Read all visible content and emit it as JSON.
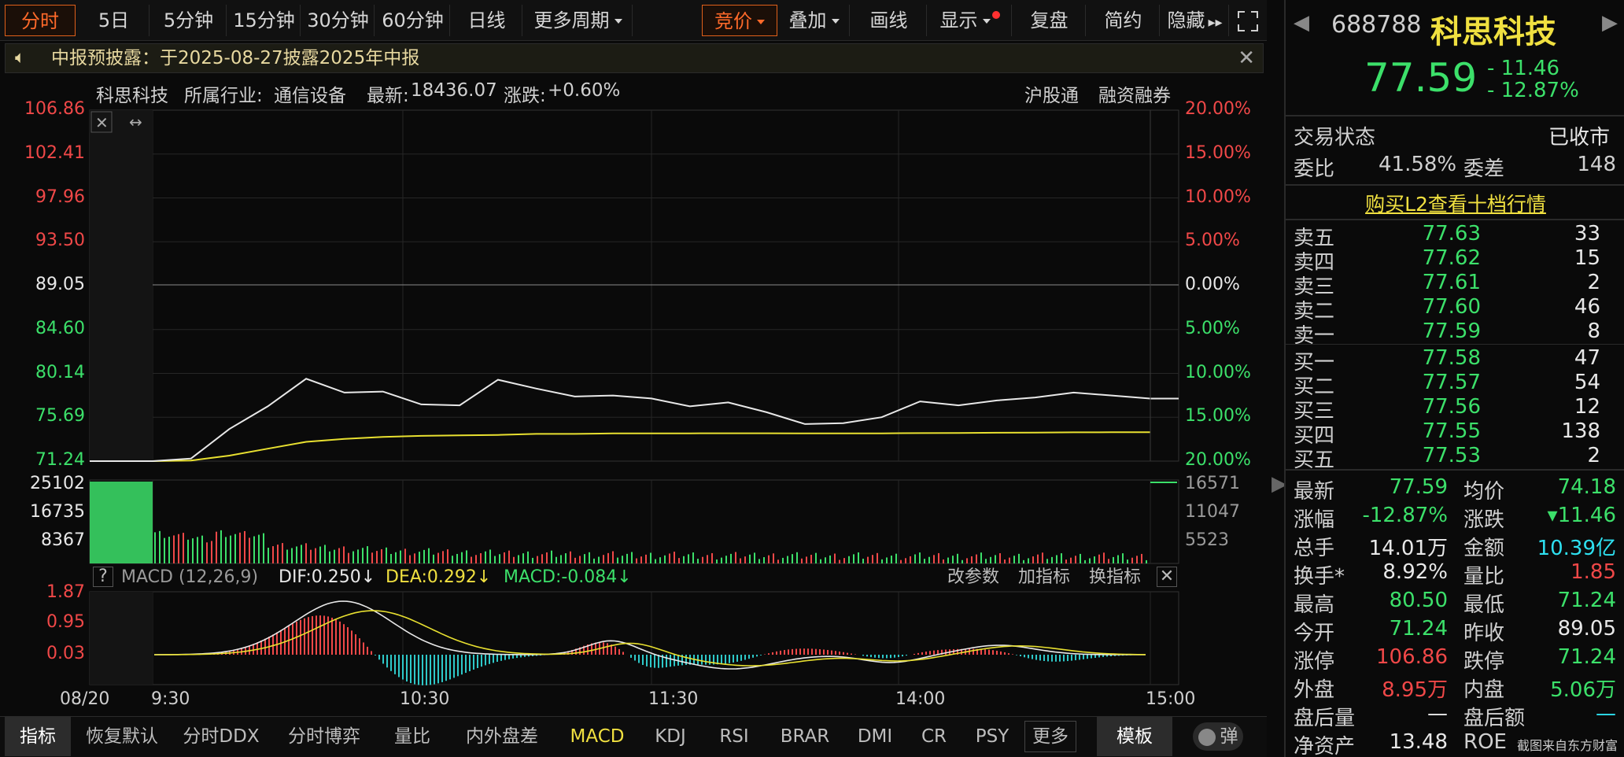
{
  "toolbar": {
    "tabs": [
      "分时",
      "5日",
      "5分钟",
      "15分钟",
      "30分钟",
      "60分钟",
      "日线",
      "更多周期"
    ],
    "right_tabs": [
      "竞价",
      "叠加",
      "画线",
      "显示",
      "复盘",
      "简约",
      "隐藏"
    ]
  },
  "notice": {
    "text": "中报预披露：于2025-08-27披露2025年中报"
  },
  "info_line": {
    "name": "科思科技",
    "industry_label": "所属行业:",
    "industry": "通信设备",
    "latest_label": "最新:",
    "latest": "18436.07",
    "change_label": "涨跌:",
    "change": "+0.60%",
    "tag1": "沪股通",
    "tag2": "融资融券"
  },
  "price_axis": {
    "left": [
      "106.86",
      "102.41",
      "97.96",
      "93.50",
      "89.05",
      "84.60",
      "80.14",
      "75.69",
      "71.24"
    ],
    "right": [
      "20.00%",
      "15.00%",
      "10.00%",
      "5.00%",
      "0.00%",
      "5.00%",
      "10.00%",
      "15.00%",
      "20.00%"
    ]
  },
  "volume_axis": {
    "left": [
      "25102",
      "16735",
      "8367"
    ],
    "right": [
      "16571",
      "11047",
      "5523"
    ]
  },
  "macd_header": {
    "help": "?",
    "name": "MACD (12,26,9)",
    "dif": "DIF:0.250↓",
    "dea": "DEA:0.292↓",
    "macd": "MACD:-0.084↓",
    "btn1": "改参数",
    "btn2": "加指标",
    "btn3": "换指标"
  },
  "macd_axis": [
    "1.87",
    "0.95",
    "0.03"
  ],
  "time_axis": [
    "08/20",
    "9:30",
    "10:30",
    "11:30",
    "14:00",
    "15:00"
  ],
  "bottom_tabs": [
    "指标",
    "恢复默认",
    "分时DDX",
    "分时博弈",
    "量比",
    "内外盘差",
    "MACD",
    "KDJ",
    "RSI",
    "BRAR",
    "DMI",
    "CR",
    "PSY",
    "更多",
    "模板",
    "弹"
  ],
  "chart_data": {
    "type": "line",
    "title": "",
    "prev_close": 89.05,
    "ylim": [
      71.24,
      106.86
    ],
    "x": [
      "9:30",
      "9:45",
      "10:00",
      "10:05",
      "10:10",
      "10:15",
      "10:20",
      "10:30",
      "10:40",
      "10:50",
      "10:55",
      "11:00",
      "11:10",
      "11:20",
      "11:30",
      "13:10",
      "13:20",
      "13:30",
      "13:40",
      "13:50",
      "14:00",
      "14:10",
      "14:20",
      "14:30",
      "14:40",
      "14:50",
      "15:00"
    ],
    "series": [
      {
        "values": [
          71.24,
          71.5,
          74.5,
          76.8,
          79.6,
          78.2,
          78.3,
          77.0,
          76.9,
          79.5,
          78.6,
          77.8,
          77.9,
          77.6,
          76.8,
          77.2,
          76.2,
          75.0,
          75.1,
          75.7,
          77.3,
          76.9,
          77.4,
          77.7,
          78.2,
          77.9,
          77.59
        ]
      },
      {
        "values": [
          71.24,
          71.3,
          71.8,
          72.5,
          73.2,
          73.5,
          73.7,
          73.8,
          73.85,
          73.9,
          74.0,
          74.0,
          74.05,
          74.05,
          74.06,
          74.07,
          74.07,
          74.05,
          74.05,
          74.06,
          74.08,
          74.1,
          74.12,
          74.14,
          74.16,
          74.17,
          74.18
        ]
      }
    ]
  },
  "right_panel": {
    "code": "688788",
    "name": "科思科技",
    "price": "77.59",
    "change": "- 11.46",
    "change_pct": "- 12.87%",
    "status_label": "交易状态",
    "status": "已收市",
    "weibi_label": "委比",
    "weibi": "41.58%",
    "weicha_label": "委差",
    "weicha": "148",
    "l2_link": "购买L2查看十档行情",
    "asks": [
      {
        "label": "卖五",
        "price": "77.63",
        "vol": "33"
      },
      {
        "label": "卖四",
        "price": "77.62",
        "vol": "15"
      },
      {
        "label": "卖三",
        "price": "77.61",
        "vol": "2"
      },
      {
        "label": "卖二",
        "price": "77.60",
        "vol": "46"
      },
      {
        "label": "卖一",
        "price": "77.59",
        "vol": "8"
      }
    ],
    "bids": [
      {
        "label": "买一",
        "price": "77.58",
        "vol": "47"
      },
      {
        "label": "买二",
        "price": "77.57",
        "vol": "54"
      },
      {
        "label": "买三",
        "price": "77.56",
        "vol": "12"
      },
      {
        "label": "买四",
        "price": "77.55",
        "vol": "138"
      },
      {
        "label": "买五",
        "price": "77.53",
        "vol": "2"
      }
    ],
    "stats": [
      {
        "l1": "最新",
        "v1": "77.59",
        "l2": "均价",
        "v2": "74.18"
      },
      {
        "l1": "涨幅",
        "v1": "-12.87%",
        "l2": "涨跌",
        "v2": "▾11.46"
      },
      {
        "l1": "总手",
        "v1": "14.01万",
        "l2": "金额",
        "v2": "10.39亿"
      },
      {
        "l1": "换手*",
        "v1": "8.92%",
        "l2": "量比",
        "v2": "1.85"
      },
      {
        "l1": "最高",
        "v1": "80.50",
        "l2": "最低",
        "v2": "71.24"
      },
      {
        "l1": "今开",
        "v1": "71.24",
        "l2": "昨收",
        "v2": "89.05"
      },
      {
        "l1": "涨停",
        "v1": "106.86",
        "l2": "跌停",
        "v2": "71.24"
      },
      {
        "l1": "外盘",
        "v1": "8.95万",
        "l2": "内盘",
        "v2": "5.06万"
      },
      {
        "l1": "盘后量",
        "v1": "—",
        "l2": "盘后额",
        "v2": "—"
      },
      {
        "l1": "净资产",
        "v1": "13.48",
        "l2": "ROE",
        "v2": ""
      }
    ],
    "watermark": "截图来自东方财富"
  }
}
